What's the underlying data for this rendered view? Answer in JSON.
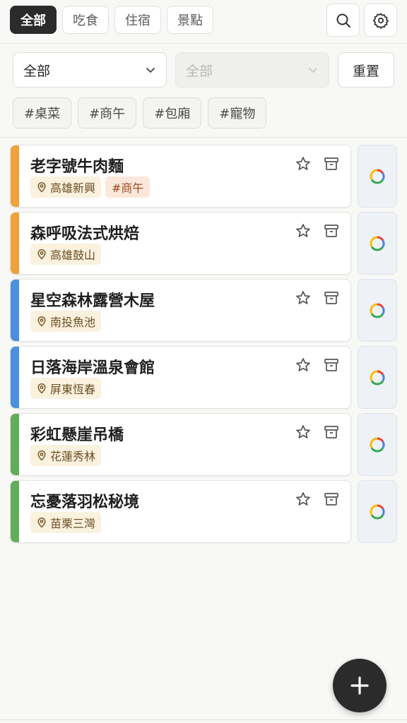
{
  "categories": [
    {
      "label": "全部",
      "active": true
    },
    {
      "label": "吃食",
      "active": false
    },
    {
      "label": "住宿",
      "active": false
    },
    {
      "label": "景點",
      "active": false
    }
  ],
  "icons": {
    "search": "search-icon",
    "settings": "gear-icon",
    "add": "plus-icon"
  },
  "filters": {
    "select_primary": "全部",
    "select_secondary": "全部",
    "reset_label": "重置",
    "tags": [
      "#桌菜",
      "#商午",
      "#包廂",
      "#寵物"
    ]
  },
  "places": [
    {
      "title": "老字號牛肉麵",
      "location": "高雄新興",
      "tag": "#商午",
      "color": "#f0a23a"
    },
    {
      "title": "森呼吸法式烘焙",
      "location": "高雄鼓山",
      "tag": "",
      "color": "#f0a23a"
    },
    {
      "title": "星空森林露營木屋",
      "location": "南投魚池",
      "tag": "",
      "color": "#4a8fe0"
    },
    {
      "title": "日落海岸溫泉會館",
      "location": "屏東恆春",
      "tag": "",
      "color": "#4a8fe0"
    },
    {
      "title": "彩虹懸崖吊橋",
      "location": "花蓮秀林",
      "tag": "",
      "color": "#62ad58"
    },
    {
      "title": "忘憂落羽松秘境",
      "location": "苗栗三灣",
      "tag": "",
      "color": "#62ad58"
    }
  ]
}
